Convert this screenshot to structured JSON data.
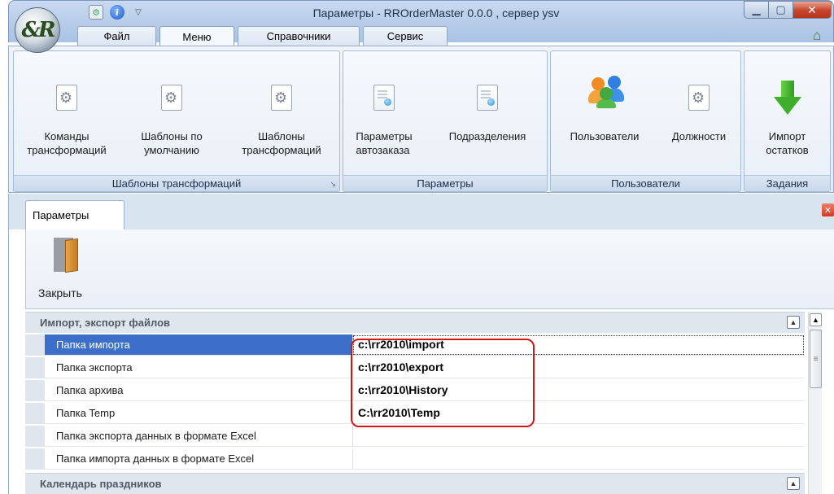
{
  "window": {
    "title": "Параметры - RROrderMaster 0.0.0 , сервер ysv",
    "orb_text": "&R"
  },
  "ribbon_tabs": [
    {
      "label": "Файл"
    },
    {
      "label": "Меню"
    },
    {
      "label": "Справочники"
    },
    {
      "label": "Сервис"
    }
  ],
  "ribbon_groups": [
    {
      "label": "Шаблоны трансформаций",
      "buttons": [
        {
          "label": "Команды\nтрансформаций",
          "icon": "gear-document-icon"
        },
        {
          "label": "Шаблоны по\nумолчанию",
          "icon": "gear-document-icon"
        },
        {
          "label": "Шаблоны\nтрансформаций",
          "icon": "gear-document-icon"
        }
      ]
    },
    {
      "label": "Параметры",
      "buttons": [
        {
          "label": "Параметры\nавтозаказа",
          "icon": "parameters-document-icon"
        },
        {
          "label": "Подразделения",
          "icon": "parameters-document-icon"
        }
      ]
    },
    {
      "label": "Пользователи",
      "buttons": [
        {
          "label": "Пользователи",
          "icon": "users-icon"
        },
        {
          "label": "Должности",
          "icon": "gear-document-icon"
        }
      ]
    },
    {
      "label": "Задания",
      "buttons": [
        {
          "label": "Импорт\nостатков",
          "icon": "green-down-arrow-icon"
        }
      ]
    }
  ],
  "document_tab": {
    "label": "Параметры"
  },
  "toolbar": {
    "close_label": "Закрыть"
  },
  "property_grid": {
    "categories": [
      {
        "label": "Импорт, экспорт файлов",
        "expanded": true
      },
      {
        "label": "Календарь праздников",
        "expanded": false
      }
    ],
    "rows": [
      {
        "name": "Папка импорта",
        "value": "c:\\rr2010\\import",
        "selected": true
      },
      {
        "name": "Папка экспорта",
        "value": "c:\\rr2010\\export"
      },
      {
        "name": "Папка архива",
        "value": "c:\\rr2010\\History"
      },
      {
        "name": "Папка Temp",
        "value": "C:\\rr2010\\Temp"
      },
      {
        "name": "Папка экспорта данных в формате Excel",
        "value": ""
      },
      {
        "name": "Папка импорта данных в формате Excel",
        "value": ""
      }
    ]
  },
  "colors": {
    "selection": "#3b6fc9",
    "highlight_outline": "#d41818"
  }
}
